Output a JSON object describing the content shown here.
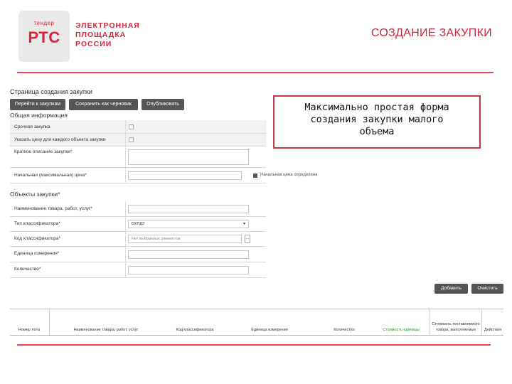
{
  "header": {
    "logo_small": "тендер",
    "logo_big": "РТС",
    "logo_lines": [
      "ЭЛЕКТРОННАЯ",
      "ПЛОЩАДКА",
      "РОССИИ"
    ],
    "slide_title": "СОЗДАНИЕ ЗАКУПКИ"
  },
  "callout": {
    "lines": [
      "Максимально простая форма",
      "создания закупки малого",
      "объема"
    ]
  },
  "form": {
    "title": "Страница создания закупки",
    "buttons": {
      "to_purchases": "Перейти к закупкам",
      "save_draft": "Сохранить как черновик",
      "publish": "Опубликовать"
    },
    "general_section": "Общая информация",
    "fields": {
      "urgent": "Срочная закупка",
      "price_per_item": "Указать цену для каждого объекта закупки",
      "short_description": "Краткое описание закупки",
      "initial_price": "Начальная (максимальная) цена",
      "price_defined_toggle": "Начальная цена определена"
    },
    "objects_section": "Объекты закупки",
    "object_fields": {
      "name": "Наименование товара, работ, услуг",
      "classifier_type": "Тип классификатора",
      "classifier_type_value": "ОКПД2",
      "classifier_code": "Код классификатора",
      "classifier_code_placeholder": "Нет выбранных элементов",
      "unit": "Единица измерения",
      "quantity": "Количество"
    },
    "actions": {
      "add": "Добавить",
      "clear": "Очистить"
    },
    "required_mark": "*"
  },
  "table": {
    "headers": [
      "Номер лота",
      "Наименование товара, работ, услуг",
      "Код классификатора",
      "Единица измерения",
      "Количество",
      "Стоимость единицы",
      "Стоимость поставляемого товара, выполняемых",
      "Действия"
    ]
  }
}
